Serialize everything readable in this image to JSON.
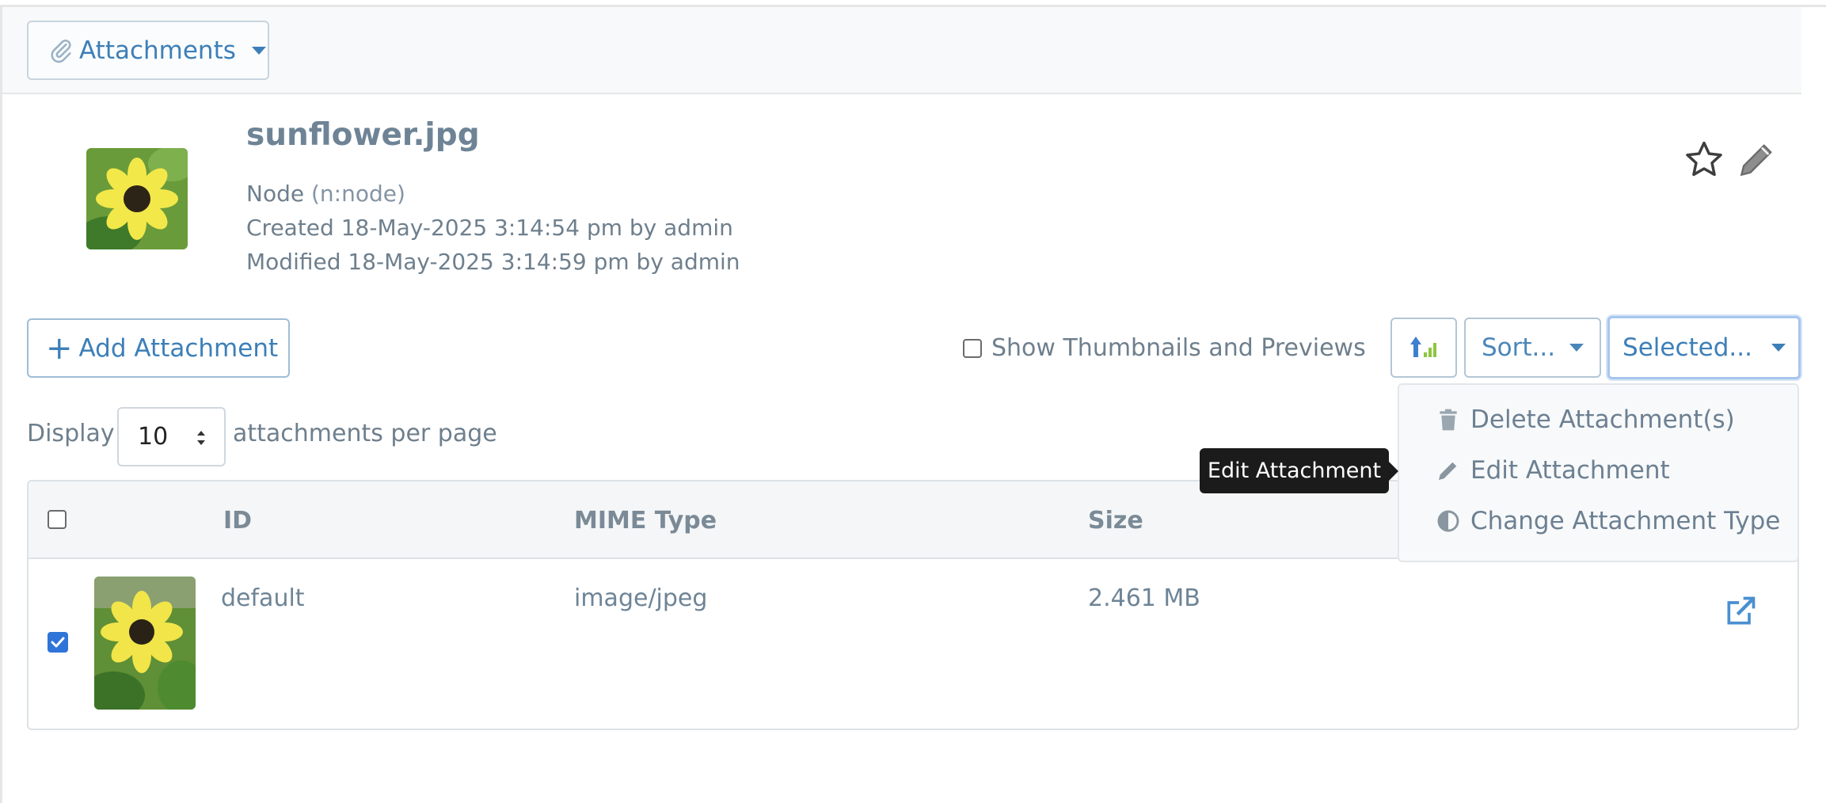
{
  "header": {
    "attachments_button_label": "Attachments",
    "attachments_button_icon": "paperclip-icon"
  },
  "node": {
    "title": "sunflower.jpg",
    "type_label": "Node",
    "type_id": "(n:node)",
    "created": "Created 18-May-2025 3:14:54 pm by admin",
    "modified": "Modified 18-May-2025 3:14:59 pm by admin",
    "actions": [
      "star-icon",
      "pencil-icon"
    ]
  },
  "toolbar": {
    "add_label": "Add Attachment",
    "add_prefix": "+",
    "show_thumbnails_label": "Show Thumbnails and Previews",
    "show_thumbnails_checked": false,
    "sort_direction_icon": "sort-ascending-icon",
    "sort_label": "Sort...",
    "selected_label": "Selected..."
  },
  "display": {
    "label_before": "Display",
    "per_page_value": "10",
    "label_after": "attachments per page"
  },
  "table": {
    "columns": [
      "ID",
      "MIME Type",
      "Size"
    ],
    "rows": [
      {
        "selected": true,
        "id": "default",
        "mime": "image/jpeg",
        "size": "2.461 MB"
      }
    ]
  },
  "selected_menu": {
    "items": [
      {
        "label": "Delete Attachment(s)",
        "icon": "trash-icon"
      },
      {
        "label": "Edit Attachment",
        "icon": "pencil-icon"
      },
      {
        "label": "Change Attachment Type",
        "icon": "half-circle-icon"
      }
    ]
  },
  "tooltip": {
    "text": "Edit Attachment"
  },
  "colors": {
    "accent_blue": "#3d7fb8",
    "checkbox_blue": "#2f74d8",
    "tooltip_bg": "#1b1b1b"
  }
}
